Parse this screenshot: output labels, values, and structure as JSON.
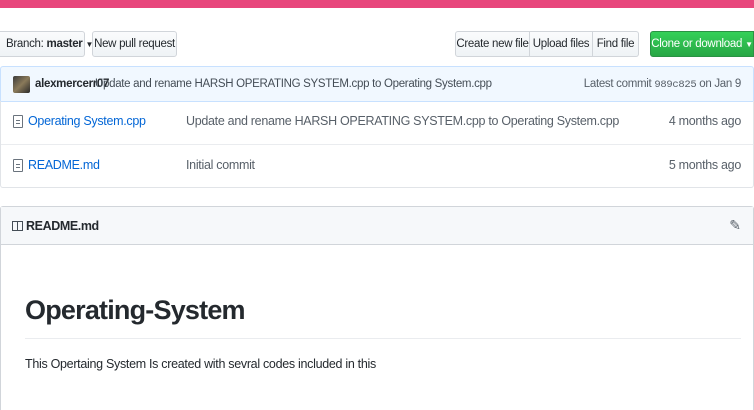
{
  "colors": {
    "accent_bar": "#e8467c",
    "clone_button": "#2ea44f",
    "link": "#0366d6"
  },
  "toolbar": {
    "branch_prefix": "Branch:",
    "branch_name": "master",
    "new_pull_request": "New pull request",
    "create_new_file": "Create new file",
    "upload_files": "Upload files",
    "find_file": "Find file",
    "clone_or_download": "Clone or download"
  },
  "latest_commit": {
    "author": "alexmercerr07",
    "message": "Update and rename HARSH OPERATING SYSTEM.cpp to Operating System.cpp",
    "prefix": "Latest commit",
    "sha": "989c825",
    "date": "on Jan 9"
  },
  "files": [
    {
      "icon": "file-icon",
      "name": "Operating System.cpp",
      "commit": "Update and rename HARSH OPERATING SYSTEM.cpp to Operating System.cpp",
      "age": "4 months ago"
    },
    {
      "icon": "file-icon",
      "name": "README.md",
      "commit": "Initial commit",
      "age": "5 months ago"
    }
  ],
  "readme": {
    "title": "README.md",
    "heading": "Operating-System",
    "paragraph": "This Opertaing System Is created with sevral codes included in this"
  }
}
